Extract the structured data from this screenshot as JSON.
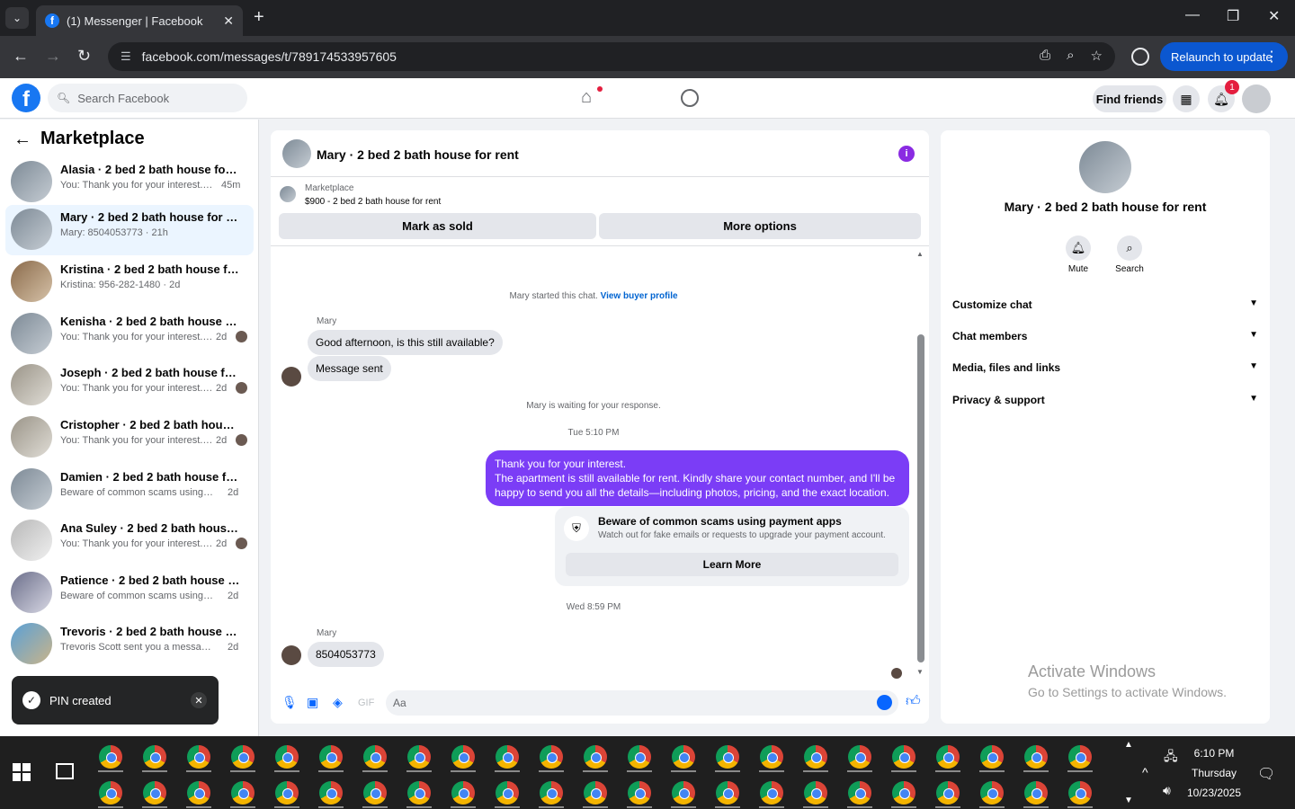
{
  "browser": {
    "tab_title": "(1) Messenger | Facebook",
    "url": "facebook.com/messages/t/789174533957605",
    "relaunch_label": "Relaunch to update"
  },
  "fb": {
    "search_placeholder": "Search Facebook",
    "find_friends": "Find friends",
    "notif_count": "1"
  },
  "left": {
    "title": "Marketplace",
    "conversations": [
      {
        "name": "Alasia · 2 bed 2 bath house for rent",
        "preview": "You: Thank you for your interest. Th...",
        "time": "45m"
      },
      {
        "name": "Mary · 2 bed 2 bath house for rent",
        "preview": "Mary: 8504053773 · 21h",
        "time": ""
      },
      {
        "name": "Kristina · 2 bed 2 bath house for re...",
        "preview": "Kristina: 956-282-1480 · 2d",
        "time": ""
      },
      {
        "name": "Kenisha · 2 bed 2 bath house for...",
        "preview": "You: Thank you for your interest. Th...",
        "time": "2d"
      },
      {
        "name": "Joseph · 2 bed 2 bath house for ...",
        "preview": "You: Thank you for your interest. Th...",
        "time": "2d"
      },
      {
        "name": "Cristopher · 2 bed 2 bath house ...",
        "preview": "You: Thank you for your interest. Th...",
        "time": "2d"
      },
      {
        "name": "Damien · 2 bed 2 bath house for r...",
        "preview": "Beware of common scams using pay...",
        "time": "2d"
      },
      {
        "name": "Ana Suley · 2 bed 2 bath house f...",
        "preview": "You: Thank you for your interest. Th...",
        "time": "2d"
      },
      {
        "name": "Patience · 2 bed 2 bath house for r...",
        "preview": "Beware of common scams using pay...",
        "time": "2d"
      },
      {
        "name": "Trevoris · 2 bed 2 bath house for r...",
        "preview": "Trevoris Scott sent you a message ab...",
        "time": "2d"
      }
    ],
    "toast": "PIN created"
  },
  "chat": {
    "title": "Mary · 2 bed 2 bath house for rent",
    "marketplace_label": "Marketplace",
    "listing": "$900 - 2 bed 2 bath house for rent",
    "mark_sold": "Mark as sold",
    "more_options": "More options",
    "started": "Mary started this chat.",
    "view_profile": "View buyer profile",
    "sender": "Mary",
    "msg1": "Good afternoon, is this still available?",
    "msg2": "Message sent",
    "waiting": "Mary is waiting for your response.",
    "ts1": "Tue 5:10 PM",
    "out_line1": "Thank you for your interest.",
    "out_line2": "The apartment is still available for rent. Kindly share your contact number, and I'll be happy to send you all the details—including photos, pricing, and the exact location.",
    "scam_title": "Beware of common scams using payment apps",
    "scam_text": "Watch out for fake emails or requests to upgrade your payment account.",
    "learn_more": "Learn More",
    "ts2": "Wed 8:59 PM",
    "msg3": "8504053773",
    "composer_placeholder": "Aa"
  },
  "right": {
    "name": "Mary · 2 bed 2 bath house for rent",
    "mute": "Mute",
    "search": "Search",
    "sections": [
      "Customize chat",
      "Chat members",
      "Media, files and links",
      "Privacy & support"
    ]
  },
  "watermark": {
    "line1": "Activate Windows",
    "line2": "Go to Settings to activate Windows."
  },
  "taskbar": {
    "time": "6:10 PM",
    "day": "Thursday",
    "date": "10/23/2025"
  },
  "colors": {
    "brand": "#1877f2",
    "outgoing_bubble": "#7b3df6",
    "chrome_dark": "#202124"
  }
}
